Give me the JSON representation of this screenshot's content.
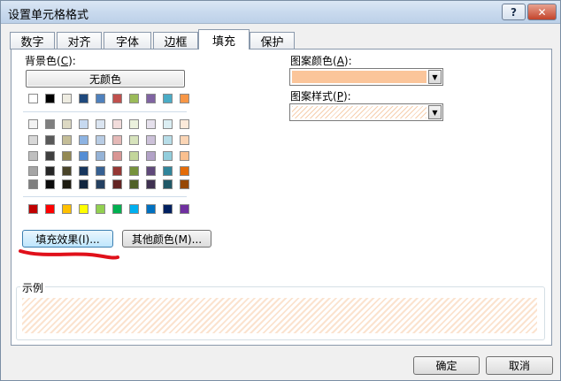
{
  "window": {
    "title": "设置单元格格式",
    "help_label": "?",
    "close_label": "✕"
  },
  "tabs": [
    {
      "label": "数字",
      "active": false
    },
    {
      "label": "对齐",
      "active": false
    },
    {
      "label": "字体",
      "active": false
    },
    {
      "label": "边框",
      "active": false
    },
    {
      "label": "填充",
      "active": true
    },
    {
      "label": "保护",
      "active": false
    }
  ],
  "background": {
    "label": "背景色",
    "hotkey": "C",
    "no_color_label": "无颜色",
    "theme_row": [
      "#ffffff",
      "#000000",
      "#eeece1",
      "#1f497d",
      "#4f81bd",
      "#c0504d",
      "#9bbb59",
      "#8064a2",
      "#4bacc6",
      "#f79646"
    ],
    "tint_rows": [
      [
        "#f2f2f2",
        "#7f7f7f",
        "#ddd9c3",
        "#c6d9f0",
        "#dbe5f1",
        "#f2dcdb",
        "#ebf1dd",
        "#e5e0ec",
        "#dbeef3",
        "#fdeada"
      ],
      [
        "#d8d8d8",
        "#595959",
        "#c4bd97",
        "#8db3e2",
        "#b8cce4",
        "#e5b9b7",
        "#d7e3bc",
        "#ccc1d9",
        "#b7dde8",
        "#fbd5b5"
      ],
      [
        "#bfbfbf",
        "#3f3f3f",
        "#938953",
        "#548dd4",
        "#95b3d7",
        "#d99694",
        "#c3d69b",
        "#b2a2c7",
        "#92cddc",
        "#fac08f"
      ],
      [
        "#a5a5a5",
        "#262626",
        "#494429",
        "#17365d",
        "#366092",
        "#953734",
        "#76923c",
        "#5f497a",
        "#31859b",
        "#e36c09"
      ],
      [
        "#7f7f7f",
        "#0c0c0c",
        "#1d1b10",
        "#0f243e",
        "#244061",
        "#632423",
        "#4f6128",
        "#3f3151",
        "#205867",
        "#974806"
      ]
    ],
    "standard_row": [
      "#c00000",
      "#ff0000",
      "#ffc000",
      "#ffff00",
      "#92d050",
      "#00b050",
      "#00b0f0",
      "#0070c0",
      "#002060",
      "#7030a0"
    ]
  },
  "buttons": {
    "fill_effects": "填充效果(I)...",
    "more_colors": "其他颜色(M)...",
    "ok": "确定",
    "cancel": "取消"
  },
  "pattern": {
    "color_label": "图案颜色",
    "color_hotkey": "A",
    "color_value": "#fbc59a",
    "style_label": "图案样式",
    "style_hotkey": "P"
  },
  "sample": {
    "label": "示例"
  },
  "colors": {
    "annotation_red": "#e0101a",
    "accent_focus": "#3c7fb1"
  }
}
